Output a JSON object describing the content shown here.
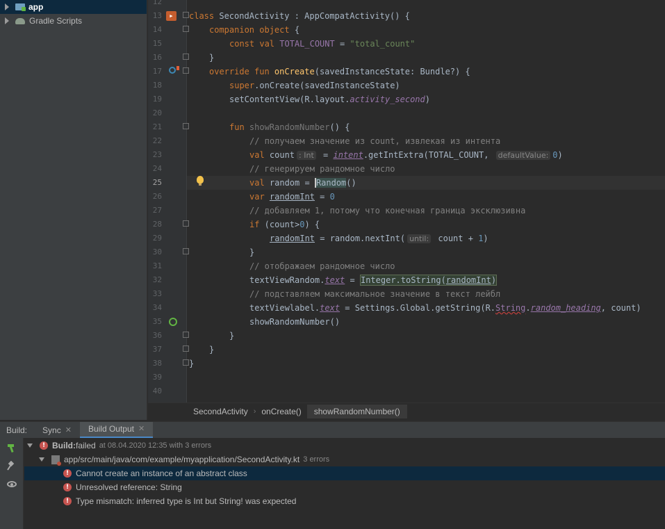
{
  "project_tree": {
    "items": [
      {
        "label": "app"
      },
      {
        "label": "Gradle Scripts"
      }
    ]
  },
  "editor": {
    "current_line": "25",
    "lines": [
      {
        "n": "12"
      },
      {
        "n": "13"
      },
      {
        "n": "14"
      },
      {
        "n": "15"
      },
      {
        "n": "16"
      },
      {
        "n": "17"
      },
      {
        "n": "18"
      },
      {
        "n": "19"
      },
      {
        "n": "20"
      },
      {
        "n": "21"
      },
      {
        "n": "22"
      },
      {
        "n": "23"
      },
      {
        "n": "24"
      },
      {
        "n": "25"
      },
      {
        "n": "26"
      },
      {
        "n": "27"
      },
      {
        "n": "28"
      },
      {
        "n": "29"
      },
      {
        "n": "30"
      },
      {
        "n": "31"
      },
      {
        "n": "32"
      },
      {
        "n": "33"
      },
      {
        "n": "34"
      },
      {
        "n": "35"
      },
      {
        "n": "36"
      },
      {
        "n": "37"
      },
      {
        "n": "38"
      },
      {
        "n": "39"
      },
      {
        "n": "40"
      }
    ],
    "code": {
      "l13": {
        "kw": "class",
        "name": " SecondActivity : AppCompatActivity() {"
      },
      "l14": {
        "kw": "companion object",
        "rest": " {"
      },
      "l15": {
        "kw": "const val",
        "name": " TOTAL_COUNT",
        "eq": " = ",
        "str": "\"total_count\""
      },
      "l16": {
        "text": "}"
      },
      "l17": {
        "kw": "override fun",
        "fn": " onCreate",
        "rest": "(savedInstanceState: Bundle?) {"
      },
      "l18": {
        "kw": "super",
        "rest": ".onCreate(savedInstanceState)"
      },
      "l19": {
        "pre": "setContentView(R.layout.",
        "prop": "activity_second",
        "post": ")"
      },
      "l21": {
        "kw": "fun",
        "fn": " showRandomNumber",
        "rest": "() {"
      },
      "l22": {
        "cmt": "// получаем значение из count, извлекая из интента"
      },
      "l23": {
        "kw": "val",
        "name": " count",
        "hint_type": ": Int",
        "eq": " = ",
        "prop": "intent",
        "call": ".getIntExtra(TOTAL_COUNT, ",
        "hint_param": "defaultValue:",
        "num": "0",
        "post": ")"
      },
      "l24": {
        "cmt": "// генерируем рандомное число"
      },
      "l25": {
        "kw": "val",
        "name": " random = ",
        "cls": "Random",
        "post": "()"
      },
      "l26": {
        "kw": "var",
        "name": "randomInt",
        "eq": " = ",
        "num": "0"
      },
      "l27": {
        "cmt": "// добавляем 1, потому что конечная граница эксклюзивна"
      },
      "l28": {
        "kw": "if",
        "rest": " (count>",
        "num": "0",
        "post": ") {"
      },
      "l29": {
        "name": "randomInt",
        "mid": " = random.nextInt(",
        "hint_param": "until:",
        "rest": " count + ",
        "num": "1",
        "post": ")"
      },
      "l30": {
        "text": "}"
      },
      "l31": {
        "cmt": "// отображаем рандомное число"
      },
      "l32": {
        "pre": "textViewRandom.",
        "prop": "text",
        "eq": " = ",
        "hl": "Integer.toString(",
        "hl_var": "randomInt",
        "hl_end": ")"
      },
      "l33": {
        "cmt": "// подставляем максимальное значение в текст лейбл"
      },
      "l34": {
        "pre": "textViewlabel.",
        "prop": "text",
        "mid": " = Settings.Global.getString(R.",
        "err": "String",
        "dot": ".",
        "prop2": "random_heading",
        "post": ", count)"
      },
      "l35": {
        "text": "showRandomNumber()"
      },
      "l36": {
        "text": "}"
      },
      "l37": {
        "text": "}"
      },
      "l38": {
        "text": "}"
      }
    }
  },
  "breadcrumb": [
    "SecondActivity",
    "onCreate()",
    "showRandomNumber()"
  ],
  "build": {
    "title": "Build:",
    "tabs": [
      {
        "label": "Sync"
      },
      {
        "label": "Build Output"
      }
    ],
    "status_bold": "Build:",
    "status_text": " failed",
    "status_detail": "at 08.04.2020 12:35 with 3 errors",
    "file_path": "app/src/main/java/com/example/myapplication/SecondActivity.kt",
    "file_errors": "3 errors",
    "errors": [
      "Cannot create an instance of an abstract class",
      "Unresolved reference: String",
      "Type mismatch: inferred type is Int but String! was expected"
    ],
    "selected_error": 0
  },
  "colors": {
    "keyword": "#cc7832",
    "function": "#ffc66d",
    "string": "#6a8759",
    "comment": "#808080",
    "property": "#9876aa",
    "number": "#6897bb",
    "error": "#c75450",
    "selection": "#0d293e"
  },
  "icons": {
    "tree": [
      "folder-icon",
      "gradle-icon"
    ],
    "gutter": [
      "class-run-icon",
      "override-icon",
      "recursive-call-icon",
      "intention-bulb-icon"
    ],
    "build_side": [
      "hammer-icon",
      "pin-icon",
      "eye-icon"
    ]
  }
}
